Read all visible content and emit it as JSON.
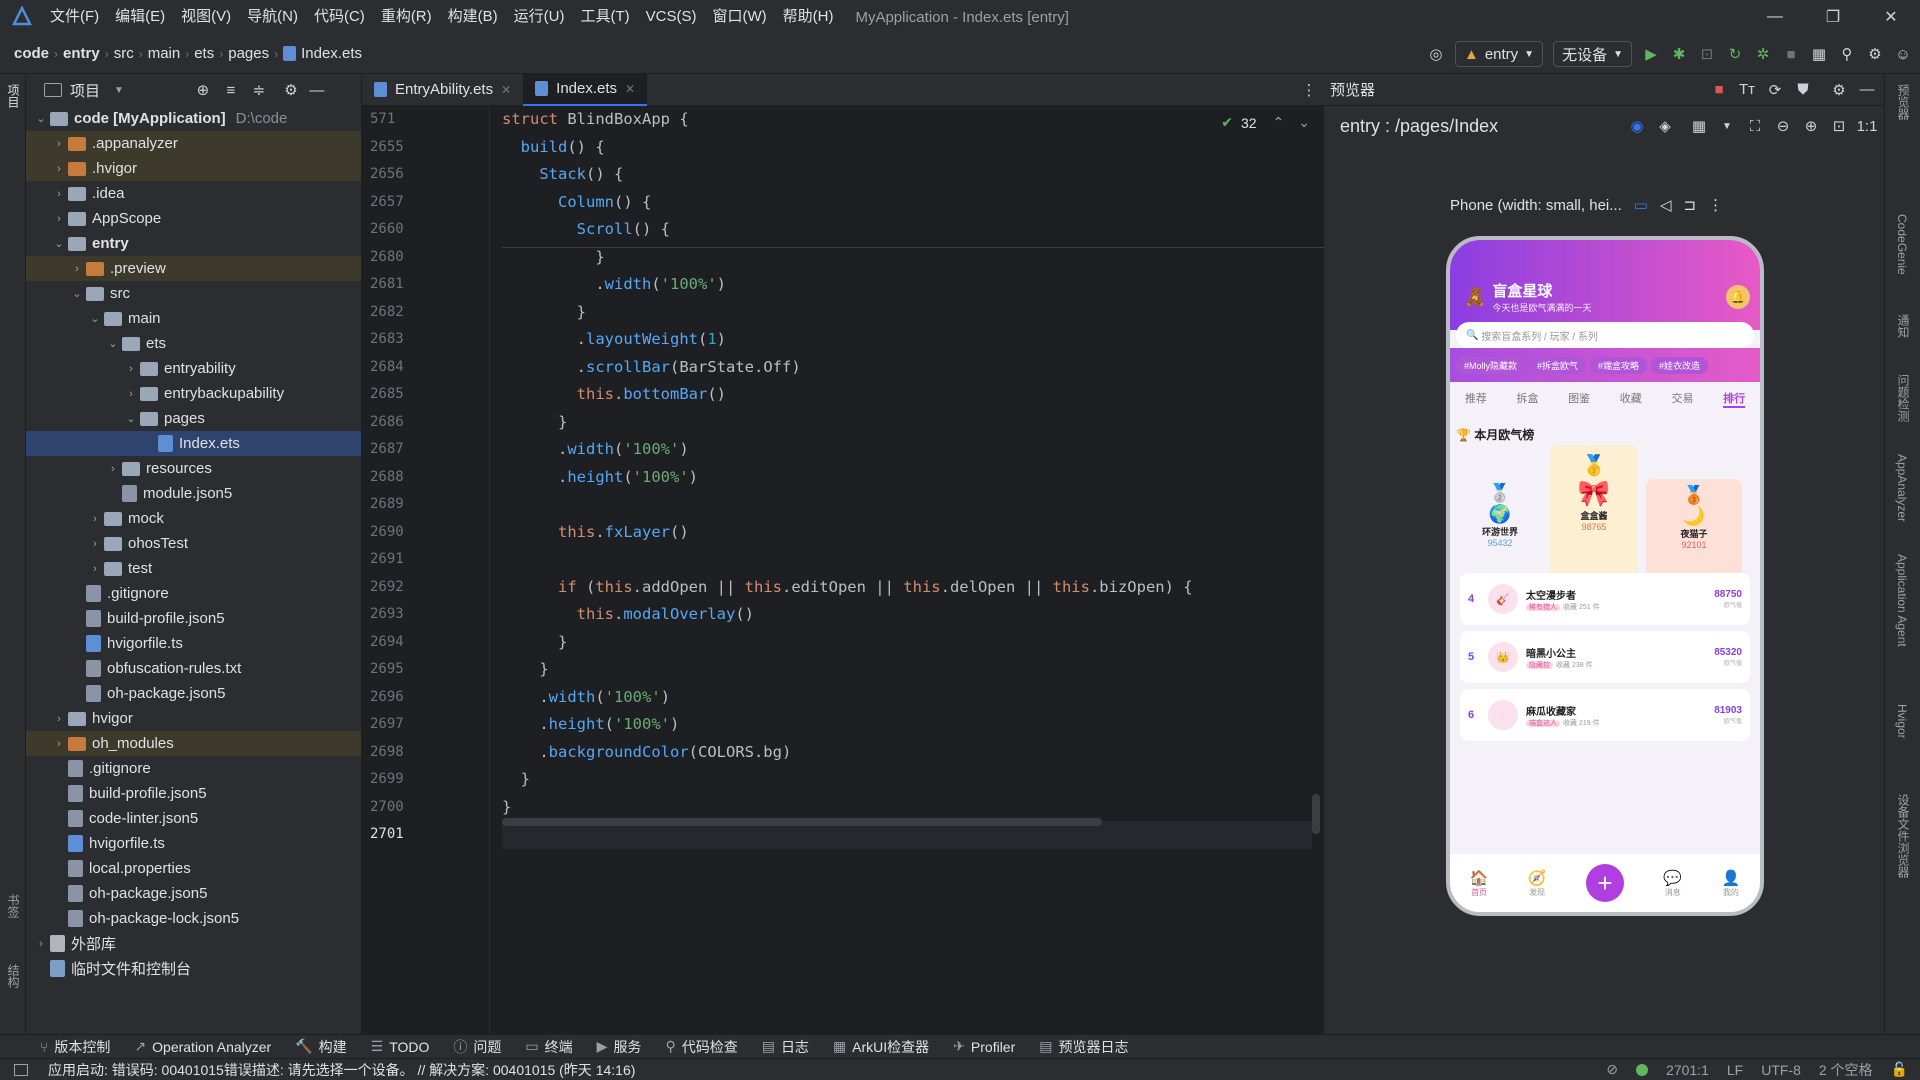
{
  "app": {
    "title": "MyApplication - Index.ets [entry]",
    "menu": [
      "文件(F)",
      "编辑(E)",
      "视图(V)",
      "导航(N)",
      "代码(C)",
      "重构(R)",
      "构建(B)",
      "运行(U)",
      "工具(T)",
      "VCS(S)",
      "窗口(W)",
      "帮助(H)"
    ]
  },
  "breadcrumb": [
    "code",
    "entry",
    "src",
    "main",
    "ets",
    "pages",
    "Index.ets"
  ],
  "toolbar": {
    "module": "entry",
    "device": "无设备"
  },
  "project": {
    "header": "项目",
    "tree": [
      {
        "label": "code [MyApplication]",
        "extra": "D:\\code",
        "depth": 0,
        "arrow": "⌄",
        "icon": "folder-blue",
        "bold": true
      },
      {
        "label": ".appanalyzer",
        "depth": 1,
        "arrow": "›",
        "icon": "folder-orange",
        "hl": true
      },
      {
        "label": ".hvigor",
        "depth": 1,
        "arrow": "›",
        "icon": "folder-orange",
        "hl": true
      },
      {
        "label": ".idea",
        "depth": 1,
        "arrow": "›",
        "icon": "folder-blue"
      },
      {
        "label": "AppScope",
        "depth": 1,
        "arrow": "›",
        "icon": "folder-blue"
      },
      {
        "label": "entry",
        "depth": 1,
        "arrow": "⌄",
        "icon": "folder-blue",
        "bold": true
      },
      {
        "label": ".preview",
        "depth": 2,
        "arrow": "›",
        "icon": "folder-orange",
        "hl": true
      },
      {
        "label": "src",
        "depth": 2,
        "arrow": "⌄",
        "icon": "folder-blue"
      },
      {
        "label": "main",
        "depth": 3,
        "arrow": "⌄",
        "icon": "folder-blue"
      },
      {
        "label": "ets",
        "depth": 4,
        "arrow": "⌄",
        "icon": "folder-blue"
      },
      {
        "label": "entryability",
        "depth": 5,
        "arrow": "›",
        "icon": "folder-blue"
      },
      {
        "label": "entrybackupability",
        "depth": 5,
        "arrow": "›",
        "icon": "folder-blue"
      },
      {
        "label": "pages",
        "depth": 5,
        "arrow": "⌄",
        "icon": "folder-blue"
      },
      {
        "label": "Index.ets",
        "depth": 6,
        "arrow": "",
        "icon": "file-ets",
        "sel": true
      },
      {
        "label": "resources",
        "depth": 4,
        "arrow": "›",
        "icon": "folder-blue"
      },
      {
        "label": "module.json5",
        "depth": 4,
        "arrow": "",
        "icon": "file"
      },
      {
        "label": "mock",
        "depth": 3,
        "arrow": "›",
        "icon": "folder-blue"
      },
      {
        "label": "ohosTest",
        "depth": 3,
        "arrow": "›",
        "icon": "folder-blue"
      },
      {
        "label": "test",
        "depth": 3,
        "arrow": "›",
        "icon": "folder-blue"
      },
      {
        "label": ".gitignore",
        "depth": 2,
        "arrow": "",
        "icon": "file"
      },
      {
        "label": "build-profile.json5",
        "depth": 2,
        "arrow": "",
        "icon": "file"
      },
      {
        "label": "hvigorfile.ts",
        "depth": 2,
        "arrow": "",
        "icon": "file-ets"
      },
      {
        "label": "obfuscation-rules.txt",
        "depth": 2,
        "arrow": "",
        "icon": "file"
      },
      {
        "label": "oh-package.json5",
        "depth": 2,
        "arrow": "",
        "icon": "file"
      },
      {
        "label": "hvigor",
        "depth": 1,
        "arrow": "›",
        "icon": "folder-blue"
      },
      {
        "label": "oh_modules",
        "depth": 1,
        "arrow": "›",
        "icon": "folder-orange",
        "hl": true
      },
      {
        "label": ".gitignore",
        "depth": 1,
        "arrow": "",
        "icon": "file"
      },
      {
        "label": "build-profile.json5",
        "depth": 1,
        "arrow": "",
        "icon": "file"
      },
      {
        "label": "code-linter.json5",
        "depth": 1,
        "arrow": "",
        "icon": "file"
      },
      {
        "label": "hvigorfile.ts",
        "depth": 1,
        "arrow": "",
        "icon": "file-ets"
      },
      {
        "label": "local.properties",
        "depth": 1,
        "arrow": "",
        "icon": "file"
      },
      {
        "label": "oh-package.json5",
        "depth": 1,
        "arrow": "",
        "icon": "file"
      },
      {
        "label": "oh-package-lock.json5",
        "depth": 1,
        "arrow": "",
        "icon": "file"
      },
      {
        "label": "外部库",
        "depth": 0,
        "arrow": "›",
        "icon": "lib"
      },
      {
        "label": "临时文件和控制台",
        "depth": 0,
        "arrow": "",
        "icon": "scratch"
      }
    ]
  },
  "editor": {
    "tabs": [
      "EntryAbility.ets",
      "Index.ets"
    ],
    "inspections": "32",
    "lines": [
      {
        "n": "571",
        "html": "<span class=\"kw\">struct</span> <span class=\"ty\">BlindBoxApp</span> {"
      },
      {
        "n": "2655",
        "html": "  <span class=\"fn\">build</span>() {"
      },
      {
        "n": "2656",
        "html": "    <span class=\"fn\">Stack</span>() {"
      },
      {
        "n": "2657",
        "html": "      <span class=\"fn\">Column</span>() {"
      },
      {
        "n": "2660",
        "html": "        <span class=\"fn\">Scroll</span>() {"
      },
      {
        "n": "2680",
        "html": "          }"
      },
      {
        "n": "2681",
        "html": "          .<span class=\"fn\">width</span>(<span class=\"str\">'100%'</span>)"
      },
      {
        "n": "2682",
        "html": "        }"
      },
      {
        "n": "2683",
        "html": "        .<span class=\"fn\">layoutWeight</span>(<span class=\"num\">1</span>)"
      },
      {
        "n": "2684",
        "html": "        .<span class=\"fn\">scrollBar</span>(BarState.Off)"
      },
      {
        "n": "2685",
        "html": "        <span class=\"kw\">this</span>.<span class=\"fn\">bottomBar</span>()"
      },
      {
        "n": "2686",
        "html": "      }"
      },
      {
        "n": "2687",
        "html": "      .<span class=\"fn\">width</span>(<span class=\"str\">'100%'</span>)"
      },
      {
        "n": "2688",
        "html": "      .<span class=\"fn\">height</span>(<span class=\"str\">'100%'</span>)"
      },
      {
        "n": "2689",
        "html": ""
      },
      {
        "n": "2690",
        "html": "      <span class=\"kw\">this</span>.<span class=\"fn\">fxLayer</span>()"
      },
      {
        "n": "2691",
        "html": ""
      },
      {
        "n": "2692",
        "html": "      <span class=\"kw\">if</span> (<span class=\"kw\">this</span>.addOpen || <span class=\"kw\">this</span>.editOpen || <span class=\"kw\">this</span>.delOpen || <span class=\"kw\">this</span>.bizOpen) {"
      },
      {
        "n": "2693",
        "html": "        <span class=\"kw\">this</span>.<span class=\"fn\">modalOverlay</span>()"
      },
      {
        "n": "2694",
        "html": "      }"
      },
      {
        "n": "2695",
        "html": "    }"
      },
      {
        "n": "2696",
        "html": "    .<span class=\"fn\">width</span>(<span class=\"str\">'100%'</span>)"
      },
      {
        "n": "2697",
        "html": "    .<span class=\"fn\">height</span>(<span class=\"str\">'100%'</span>)"
      },
      {
        "n": "2698",
        "html": "    .<span class=\"fn\">backgroundColor</span>(COLORS.bg)"
      },
      {
        "n": "2699",
        "html": "  }"
      },
      {
        "n": "2700",
        "html": "}"
      },
      {
        "n": "2701",
        "html": ""
      }
    ]
  },
  "preview": {
    "header": "预览器",
    "route": "entry : /pages/Index",
    "device": "Phone (width: small, hei...",
    "phone": {
      "app_name": "盲盒星球",
      "slogan": "今天也是欧气满满的一天",
      "search": "搜索盲盒系列 / 玩家 / 系列",
      "tags": [
        "#Molly隐藏款",
        "#拆盒欧气",
        "#端盒攻略",
        "#娃衣改造"
      ],
      "tabs": [
        "推荐",
        "拆盒",
        "图鉴",
        "收藏",
        "交易",
        "排行"
      ],
      "section": "本月欧气榜",
      "podium": [
        {
          "name": "环游世界",
          "score": "95432"
        },
        {
          "name": "盒盒酱",
          "score": "98765"
        },
        {
          "name": "夜猫子",
          "score": "92101"
        }
      ],
      "ranks": [
        {
          "pos": "4",
          "name": "太空漫步者",
          "tag": "稀有猎人",
          "sub": "收藏 251 件",
          "score": "88750",
          "unit": "欧气值"
        },
        {
          "pos": "5",
          "name": "暗黑小公主",
          "tag": "隐藏控",
          "sub": "收藏 238 件",
          "score": "85320",
          "unit": "欧气值"
        },
        {
          "pos": "6",
          "name": "麻瓜收藏家",
          "tag": "端盒达人",
          "sub": "收藏 219 件",
          "score": "81903",
          "unit": "欧气值"
        }
      ],
      "nav": [
        "首页",
        "发现",
        "消息",
        "我的"
      ]
    }
  },
  "bottom_tools": [
    "版本控制",
    "Operation Analyzer",
    "构建",
    "TODO",
    "问题",
    "终端",
    "服务",
    "代码检查",
    "日志",
    "ArkUI检查器",
    "Profiler",
    "预览器日志"
  ],
  "status": {
    "message": "应用启动: 错误码: 00401015错误描述: 请先选择一个设备。 // 解决方案: 00401015 (昨天 14:16)",
    "position": "2701:1",
    "line_sep": "LF",
    "encoding": "UTF-8",
    "indent": "2 个空格"
  },
  "right_strip": [
    "预览器",
    "CodeGenie",
    "通知",
    "问题检测",
    "AppAnalyzer",
    "Application Agent",
    "Hvigor",
    "设备文件浏览器"
  ],
  "left_strip": [
    "项目",
    "书签",
    "结构"
  ]
}
